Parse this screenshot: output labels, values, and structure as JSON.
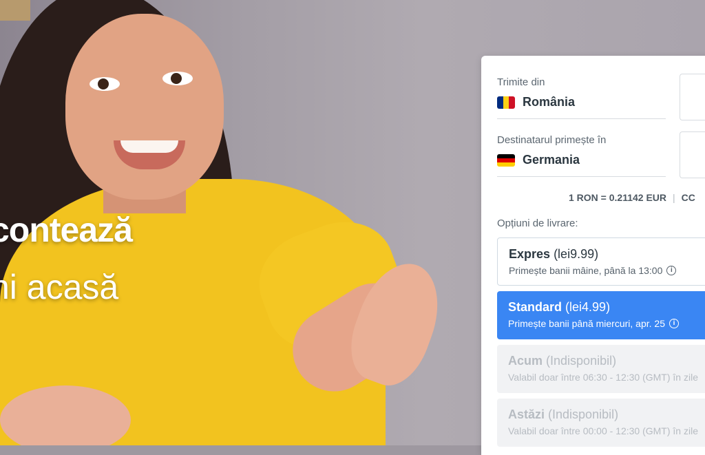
{
  "hero": {
    "line1": "contează",
    "line2": "ni acasă"
  },
  "form": {
    "send_from": {
      "label": "Trimite din",
      "country": "România",
      "flag_colors": [
        "#002b7f",
        "#fcd116",
        "#ce1126"
      ]
    },
    "receive_in": {
      "label": "Destinatarul primește în",
      "country": "Germania",
      "flag_colors": [
        "#000000",
        "#dd0000",
        "#ffce00"
      ]
    },
    "rate": {
      "text": "1 RON = 0.21142 EUR",
      "separator": "|",
      "extra": "CC"
    },
    "delivery": {
      "label": "Opțiuni de livrare:",
      "options": [
        {
          "title": "Expres",
          "price": "(lei9.99)",
          "subtitle": "Primește banii mâine, până la 13:00",
          "state": "available"
        },
        {
          "title": "Standard",
          "price": "(lei4.99)",
          "subtitle": "Primește banii până miercuri, apr. 25",
          "state": "selected"
        },
        {
          "title": "Acum",
          "price": "(Indisponibil)",
          "subtitle": "Valabil doar între 06:30 - 12:30 (GMT) în zile",
          "state": "disabled"
        },
        {
          "title": "Astăzi",
          "price": "(Indisponibil)",
          "subtitle": "Valabil doar între 00:00 - 12:30 (GMT) în zile",
          "state": "disabled"
        }
      ]
    }
  },
  "colors": {
    "accent": "#3a86f3",
    "text": "#2b3740",
    "muted": "#56616b"
  },
  "icons": {
    "info": "info-icon"
  }
}
